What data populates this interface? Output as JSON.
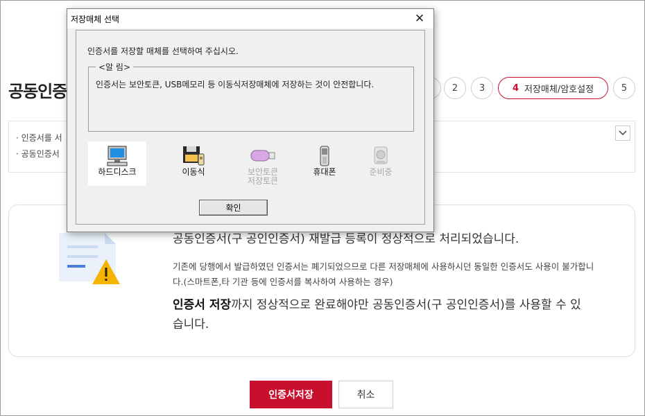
{
  "page": {
    "title": "공동인증",
    "steps": [
      "2",
      "3"
    ],
    "active_step": {
      "num": "4",
      "label": "저장매체/암호설정"
    },
    "last_step": "5",
    "notices": [
      "인증서를 서",
      "공동인증서"
    ]
  },
  "card": {
    "message_main": "공동인증서(구 공인인증서) 재발급 등록이 정상적으로 처리되었습니다.",
    "message_sub": "기존에 당행에서 발급하였던 인증서는 폐기되었으므로 다른 저장매체에 사용하시던 동일한 인증서도 사용이 불가합니다.(스마트폰,타 기관 등에 인증서를 복사하여 사용하는 경우)",
    "strong_prefix": "인증서 저장",
    "strong_rest": "까지 정상적으로 완료해야만 공동인증서(구 공인인증서)를 사용할 수 있습니다."
  },
  "buttons": {
    "save": "인증서저장",
    "cancel": "취소"
  },
  "dialog": {
    "title": "저장매체 선택",
    "close": "✕",
    "prompt": "인증서를 저장할 매체를 선택하여 주십시오.",
    "alert_legend": "<알 림>",
    "alert_text": "인증서는 보안토큰, USB메모리 등 이동식저장매체에 저장하는 것이 안전합니다.",
    "devices": [
      {
        "label": "하드디스크",
        "icon": "monitor-icon",
        "selected": true,
        "disabled": false
      },
      {
        "label": "이동식",
        "icon": "floppy-disk-icon",
        "selected": false,
        "disabled": false
      },
      {
        "label": "보안토큰\n저장토큰",
        "icon": "security-token-icon",
        "selected": false,
        "disabled": true
      },
      {
        "label": "휴대폰",
        "icon": "mobile-phone-icon",
        "selected": false,
        "disabled": false
      },
      {
        "label": "준비중",
        "icon": "preparing-icon",
        "selected": false,
        "disabled": true
      }
    ],
    "ok": "확인"
  },
  "colors": {
    "accent": "#c8102e",
    "dialog_bg": "#f0f0f0"
  }
}
